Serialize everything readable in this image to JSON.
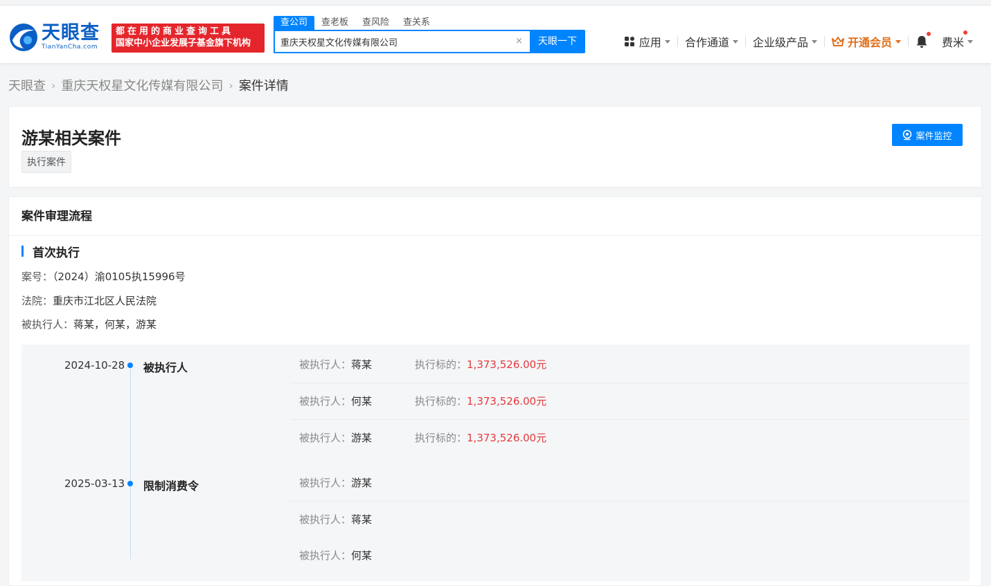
{
  "header": {
    "logo_cn": "天眼查",
    "logo_en": "TianYanCha.com",
    "slogan_line1": "都在用的商业查询工具",
    "slogan_line2": "国家中小企业发展子基金旗下机构",
    "search_tabs": [
      "查公司",
      "查老板",
      "查风险",
      "查关系"
    ],
    "search_value": "重庆天权星文化传媒有限公司",
    "clear_symbol": "×",
    "search_button": "天眼一下",
    "nav": {
      "apps": "应用",
      "partner": "合作通道",
      "enterprise": "企业级产品",
      "vip": "开通会员",
      "user": "费米"
    }
  },
  "breadcrumb": {
    "home": "天眼查",
    "company": "重庆天权星文化传媒有限公司",
    "current": "案件详情",
    "separator": "›"
  },
  "case": {
    "title": "游某相关案件",
    "tag": "执行案件",
    "monitor_button": "案件监控"
  },
  "process": {
    "section_title": "案件审理流程",
    "stage_title": "首次执行",
    "case_no_label": "案号：",
    "case_no": "（2024）渝0105执15996号",
    "court_label": "法院：",
    "court": "重庆市江北区人民法院",
    "defendants_label": "被执行人：",
    "defendants": "蒋某，何某，游某",
    "events": [
      {
        "date": "2024-10-28",
        "name": "被执行人",
        "rows": [
          {
            "label": "被执行人：",
            "value": "蒋某",
            "amount_label": "执行标的：",
            "amount": "1,373,526.00元"
          },
          {
            "label": "被执行人：",
            "value": "何某",
            "amount_label": "执行标的：",
            "amount": "1,373,526.00元"
          },
          {
            "label": "被执行人：",
            "value": "游某",
            "amount_label": "执行标的：",
            "amount": "1,373,526.00元"
          }
        ]
      },
      {
        "date": "2025-03-13",
        "name": "限制消费令",
        "rows": [
          {
            "label": "被执行人：",
            "value": "游某"
          },
          {
            "label": "被执行人：",
            "value": "蒋某"
          },
          {
            "label": "被执行人：",
            "value": "何某"
          }
        ]
      }
    ]
  },
  "colors": {
    "accent": "#0084ff",
    "slogan_bg": "#e4262c",
    "money": "#e4393c",
    "vip": "#e0701d"
  }
}
